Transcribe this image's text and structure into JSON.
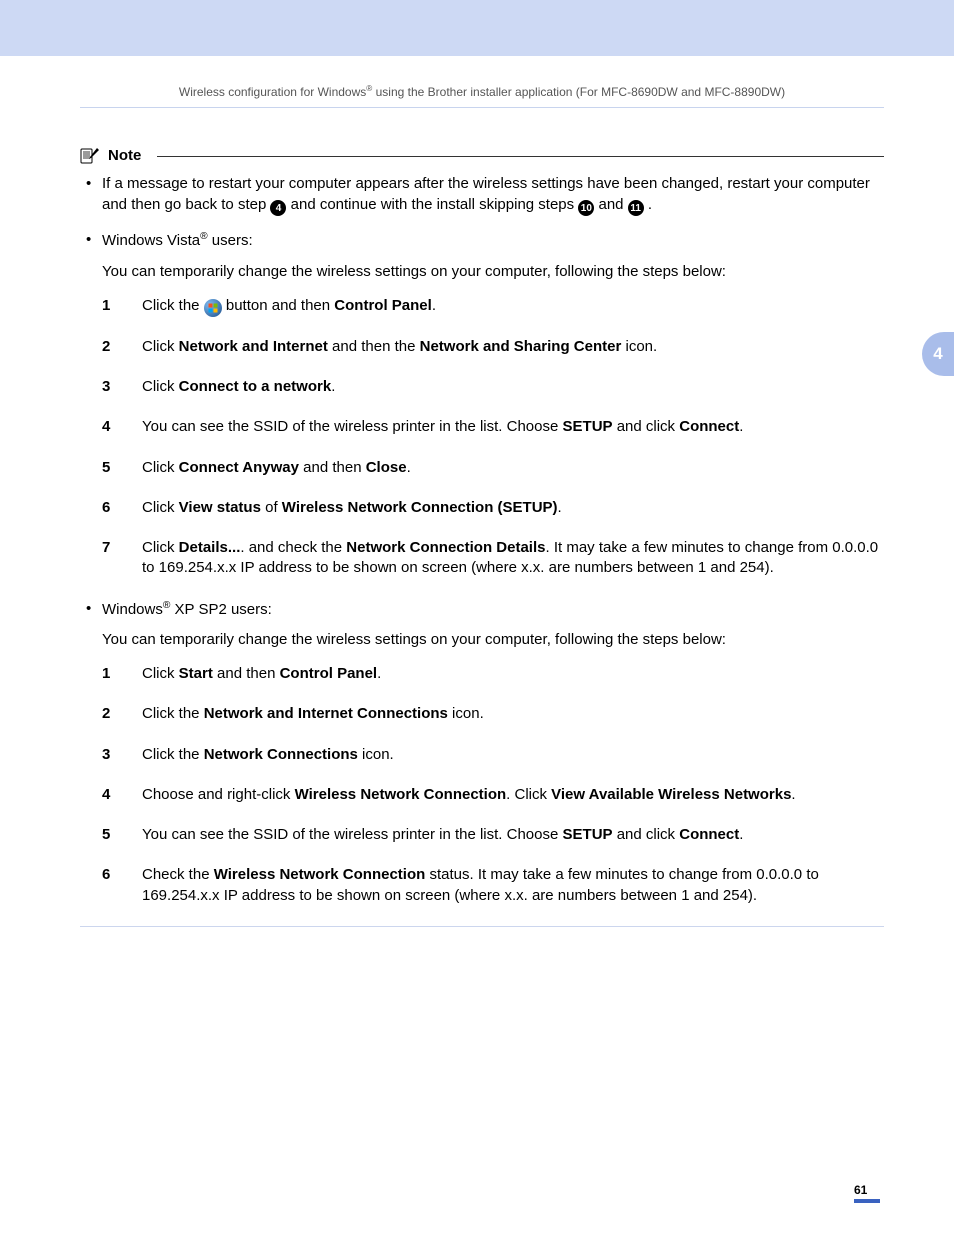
{
  "header": {
    "running_pre": "Wireless configuration for Windows",
    "running_post": " using the Brother installer application (For MFC-8690DW and MFC-8890DW)"
  },
  "side_tab": "4",
  "note": {
    "label": "Note",
    "bullet1_pre": "If a message to restart your computer appears after the wireless settings have been changed, restart your computer and then go back to step ",
    "bullet1_mid1": " and continue with the install skipping steps ",
    "bullet1_mid2": " and ",
    "bullet1_end": ".",
    "step_ref_4": "4",
    "step_ref_10": "10",
    "step_ref_11": "11",
    "vista_line_pre": "Windows Vista",
    "vista_line_post": " users:",
    "vista_intro": "You can temporarily change the wireless settings on your computer, following the steps below:",
    "vista_steps": [
      {
        "n": "1",
        "pre": "Click the ",
        "post_b1": " button and then ",
        "b1": "Control Panel",
        "end": "."
      },
      {
        "n": "2",
        "pre": "Click ",
        "b1": "Network and Internet",
        "mid": " and then the ",
        "b2": "Network and Sharing Center",
        "end": " icon."
      },
      {
        "n": "3",
        "pre": "Click ",
        "b1": "Connect to a network",
        "end": "."
      },
      {
        "n": "4",
        "pre": "You can see the SSID of the wireless printer in the list. Choose ",
        "b1": "SETUP",
        "mid": " and click ",
        "b2": "Connect",
        "end": "."
      },
      {
        "n": "5",
        "pre": "Click ",
        "b1": "Connect Anyway",
        "mid": " and then ",
        "b2": "Close",
        "end": "."
      },
      {
        "n": "6",
        "pre": "Click ",
        "b1": "View status",
        "mid": " of ",
        "b2": "Wireless Network Connection (SETUP)",
        "end": "."
      },
      {
        "n": "7",
        "pre": "Click ",
        "b1": "Details...",
        "mid": ". and check the ",
        "b2": "Network Connection Details",
        "end": ". It may take a few minutes to change from 0.0.0.0 to 169.254.x.x IP address to be shown on screen (where x.x. are numbers between 1 and 254)."
      }
    ],
    "xp_line_pre": "Windows",
    "xp_line_post": " XP SP2 users:",
    "xp_intro": "You can temporarily change the wireless settings on your computer, following the steps below:",
    "xp_steps": [
      {
        "n": "1",
        "pre": "Click ",
        "b1": "Start",
        "mid": " and then ",
        "b2": "Control Panel",
        "end": "."
      },
      {
        "n": "2",
        "pre": "Click the ",
        "b1": "Network and Internet Connections",
        "end": " icon."
      },
      {
        "n": "3",
        "pre": "Click the ",
        "b1": "Network Connections",
        "end": " icon."
      },
      {
        "n": "4",
        "pre": "Choose and right-click ",
        "b1": "Wireless Network Connection",
        "mid": ". Click ",
        "b2": "View Available Wireless Networks",
        "end": "."
      },
      {
        "n": "5",
        "pre": "You can see the SSID of the wireless printer in the list. Choose ",
        "b1": "SETUP",
        "mid": " and click ",
        "b2": "Connect",
        "end": "."
      },
      {
        "n": "6",
        "pre": "Check the ",
        "b1": "Wireless Network Connection",
        "end": " status. It may take a few minutes to change from 0.0.0.0 to 169.254.x.x IP address to be shown on screen (where x.x. are numbers between 1 and 254)."
      }
    ]
  },
  "page_number": "61"
}
